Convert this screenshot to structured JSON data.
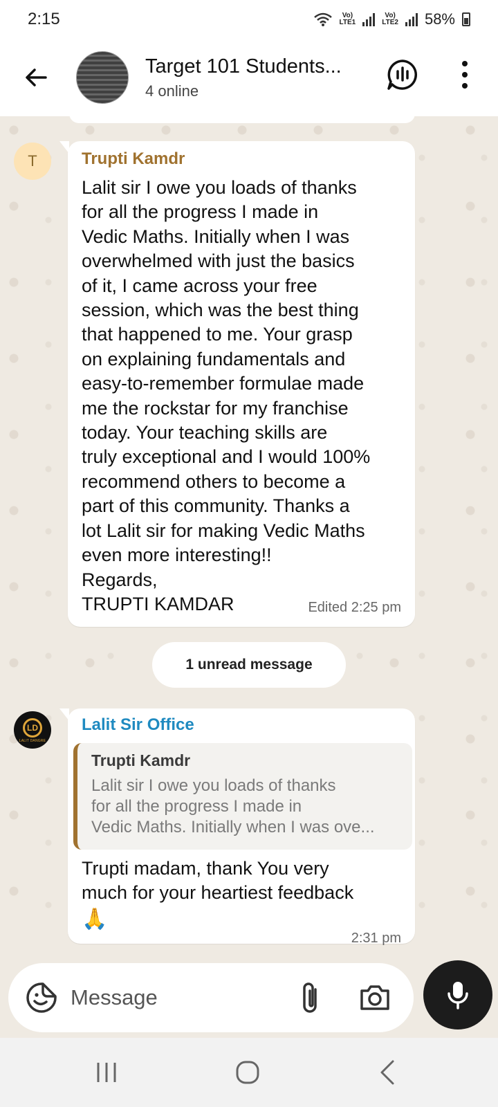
{
  "status_bar": {
    "time": "2:15",
    "sim1": "LTE1",
    "sim2": "LTE2",
    "battery": "58%"
  },
  "header": {
    "title": "Target 101 Students...",
    "subtitle": "4 online",
    "icons": [
      "back-arrow-icon",
      "voice-chat-icon",
      "more-vertical-icon"
    ]
  },
  "messages": [
    {
      "avatar_initial": "T",
      "sender": "Trupti Kamdr",
      "text": "Lalit sir I owe you loads of thanks\nfor all the progress I made in\nVedic Maths. Initially when I was\noverwhelmed with just the basics\nof it, I came across your free\nsession, which was the best thing\nthat happened to me. Your grasp\non explaining fundamentals and\neasy-to-remember formulae made\nme the rockstar for my franchise\ntoday. Your teaching skills are\ntruly exceptional and I would 100%\nrecommend others to become a\npart of this community. Thanks a\nlot Lalit sir for making Vedic Maths\neven more interesting!!\nRegards,\nTRUPTI KAMDAR",
      "meta": "Edited  2:25 pm"
    },
    {
      "avatar_initials": "LD",
      "avatar_caption": "LALIT DANGRE",
      "sender": "Lalit Sir Office",
      "quote_sender": "Trupti Kamdr",
      "quote_text": "Lalit sir I owe you loads of thanks\nfor all the progress I made in\nVedic Maths. Initially when I was ove...",
      "text": "Trupti madam, thank You very\nmuch for your heartiest feedback",
      "emoji": "🙏",
      "meta": "2:31 pm"
    }
  ],
  "unread_label": "1 unread message",
  "composer": {
    "placeholder": "Message",
    "icons": [
      "emoji-sticker-icon",
      "paperclip-icon",
      "camera-icon",
      "microphone-icon"
    ]
  },
  "navbar": {
    "icons": [
      "recents-icon",
      "home-icon",
      "back-icon"
    ]
  }
}
